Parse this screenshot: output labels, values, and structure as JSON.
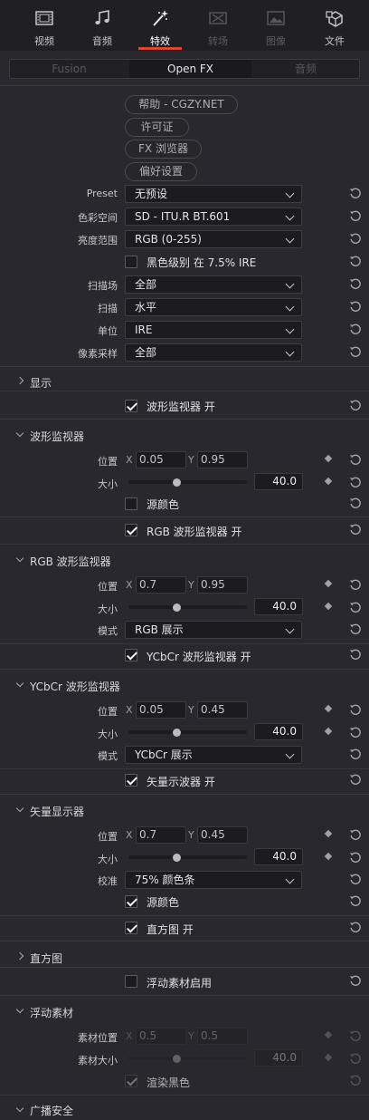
{
  "tabs": [
    {
      "label": "视频",
      "icon": "video-icon",
      "state": "normal"
    },
    {
      "label": "音频",
      "icon": "music-note-icon",
      "state": "normal"
    },
    {
      "label": "特效",
      "icon": "magic-wand-icon",
      "state": "active"
    },
    {
      "label": "转场",
      "icon": "transition-icon",
      "state": "disabled"
    },
    {
      "label": "图像",
      "icon": "image-icon",
      "state": "disabled"
    },
    {
      "label": "文件",
      "icon": "file-icon",
      "state": "normal"
    }
  ],
  "segments": [
    {
      "label": "Fusion",
      "active": false
    },
    {
      "label": "Open FX",
      "active": true
    },
    {
      "label": "音频",
      "active": false
    }
  ],
  "buttons": {
    "help": "帮助 -  CGZY.NET",
    "license": "许可证",
    "fx_browser": "FX 浏览器",
    "preferences": "偏好设置"
  },
  "settings": {
    "preset": {
      "label": "Preset",
      "value": "无预设"
    },
    "color_space": {
      "label": "色彩空间",
      "value": "SD - ITU.R BT.601"
    },
    "luma_range": {
      "label": "亮度范围",
      "value": "RGB (0-255)"
    },
    "black_level": {
      "label": "黑色级别 在 7.5% IRE",
      "checked": false
    },
    "scan_field": {
      "label": "扫描场",
      "value": "全部"
    },
    "scan": {
      "label": "扫描",
      "value": "水平"
    },
    "unit": {
      "label": "单位",
      "value": "IRE"
    },
    "pixel_sampling": {
      "label": "像素采样",
      "value": "全部"
    }
  },
  "display_section": {
    "title": "显示",
    "waveform_on": {
      "label": "波形监视器 开",
      "checked": true
    }
  },
  "waveform_section": {
    "title": "波形监视器",
    "position_label": "位置",
    "x_label": "X",
    "y_label": "Y",
    "x": "0.05",
    "y": "0.95",
    "size_label": "大小",
    "size": "40.0",
    "size_fraction": 0.41,
    "source_color": {
      "label": "源颜色",
      "checked": false
    },
    "rgb_on": {
      "label": "RGB 波形监视器 开",
      "checked": true
    }
  },
  "rgb_section": {
    "title": "RGB 波形监视器",
    "position_label": "位置",
    "x_label": "X",
    "y_label": "Y",
    "x": "0.7",
    "y": "0.95",
    "size_label": "大小",
    "size": "40.0",
    "size_fraction": 0.41,
    "mode_label": "模式",
    "mode": "RGB 展示",
    "ycbcr_on": {
      "label": "YCbCr 波形监视器 开",
      "checked": true
    }
  },
  "ycbcr_section": {
    "title": "YCbCr 波形监视器",
    "position_label": "位置",
    "x_label": "X",
    "y_label": "Y",
    "x": "0.05",
    "y": "0.45",
    "size_label": "大小",
    "size": "40.0",
    "size_fraction": 0.41,
    "mode_label": "模式",
    "mode": "YCbCr 展示",
    "vectorscope_on": {
      "label": "矢量示波器 开",
      "checked": true
    }
  },
  "vector_section": {
    "title": "矢量显示器",
    "position_label": "位置",
    "x_label": "X",
    "y_label": "Y",
    "x": "0.7",
    "y": "0.45",
    "size_label": "大小",
    "size": "40.0",
    "size_fraction": 0.41,
    "calibration_label": "校准",
    "calibration": "75% 颜色条",
    "source_color": {
      "label": "源颜色",
      "checked": true
    },
    "histogram_on": {
      "label": "直方图 开",
      "checked": true
    }
  },
  "histogram_section": {
    "title": "直方图",
    "floating_on": {
      "label": "浮动素材启用",
      "checked": false
    }
  },
  "floating_section": {
    "title": "浮动素材",
    "position_label": "素材位置",
    "x_label": "X",
    "y_label": "Y",
    "x": "0.5",
    "y": "0.5",
    "size_label": "素材大小",
    "size": "40.0",
    "size_fraction": 0.41,
    "render_black": {
      "label": "渲染黑色",
      "checked": true
    }
  },
  "broadcast_section": {
    "title": "广播安全"
  },
  "colors": {
    "accent": "#e0452f",
    "background": "#28282e",
    "field": "#1c1c20"
  }
}
